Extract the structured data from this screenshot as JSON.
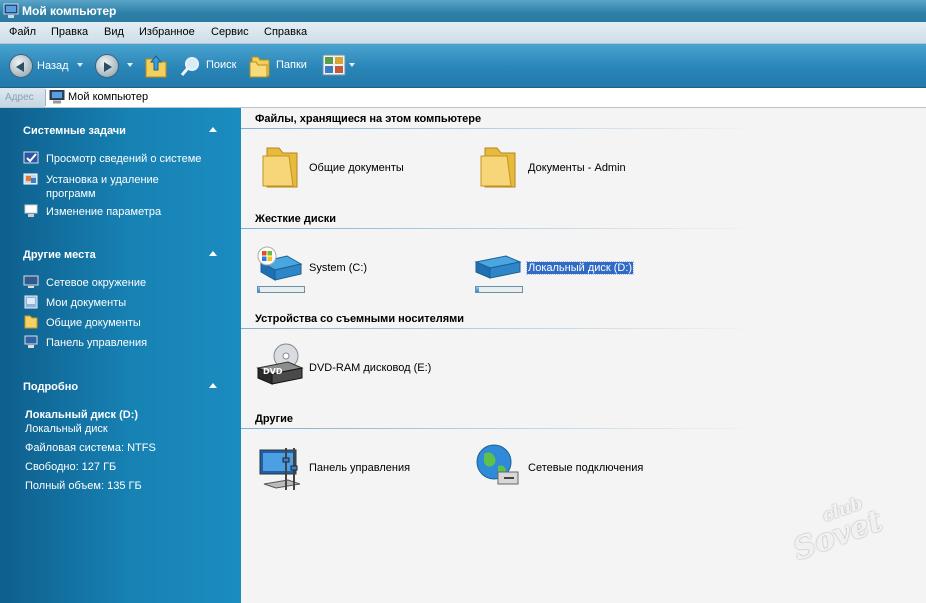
{
  "window": {
    "title": "Мой компьютер"
  },
  "menu": [
    "Файл",
    "Правка",
    "Вид",
    "Избранное",
    "Сервис",
    "Справка"
  ],
  "toolbar": {
    "back_label": "Назад",
    "search_label": "Поиск",
    "folders_label": "Папки"
  },
  "address": {
    "caption": "Адрес",
    "value": "Мой компьютер"
  },
  "sidebar": {
    "system_tasks": {
      "title": "Системные задачи",
      "items": [
        "Просмотр сведений о системе",
        "Установка и удаление программ",
        "Изменение параметра"
      ]
    },
    "other_places": {
      "title": "Другие места",
      "items": [
        "Сетевое окружение",
        "Мои документы",
        "Общие документы",
        "Панель управления"
      ]
    },
    "details": {
      "title": "Подробно",
      "name": "Локальный диск (D:)",
      "type": "Локальный диск",
      "fs": "Файловая система: NTFS",
      "free": "Свободно: 127 ГБ",
      "total": "Полный объем: 135 ГБ"
    }
  },
  "sections": {
    "stored_files": {
      "title": "Файлы, хранящиеся на этом компьютере",
      "items": [
        "Общие документы",
        "Документы - Admin"
      ]
    },
    "hard_disks": {
      "title": "Жесткие диски",
      "items": [
        {
          "label": "System (C:)",
          "used_fraction": 0.05
        },
        {
          "label": "Локальный диск (D:)",
          "used_fraction": 0.06
        }
      ]
    },
    "removable": {
      "title": "Устройства со съемными носителями",
      "items": [
        "DVD-RAM дисковод (E:)"
      ]
    },
    "other": {
      "title": "Другие",
      "items": [
        "Панель управления",
        "Сетевые подключения"
      ]
    }
  },
  "watermark": {
    "line1": "club",
    "line2": "Sovet"
  },
  "colors": {
    "accent": "#316ac5",
    "sidebar": "#1782b4",
    "toolbar": "#2a86b8"
  }
}
